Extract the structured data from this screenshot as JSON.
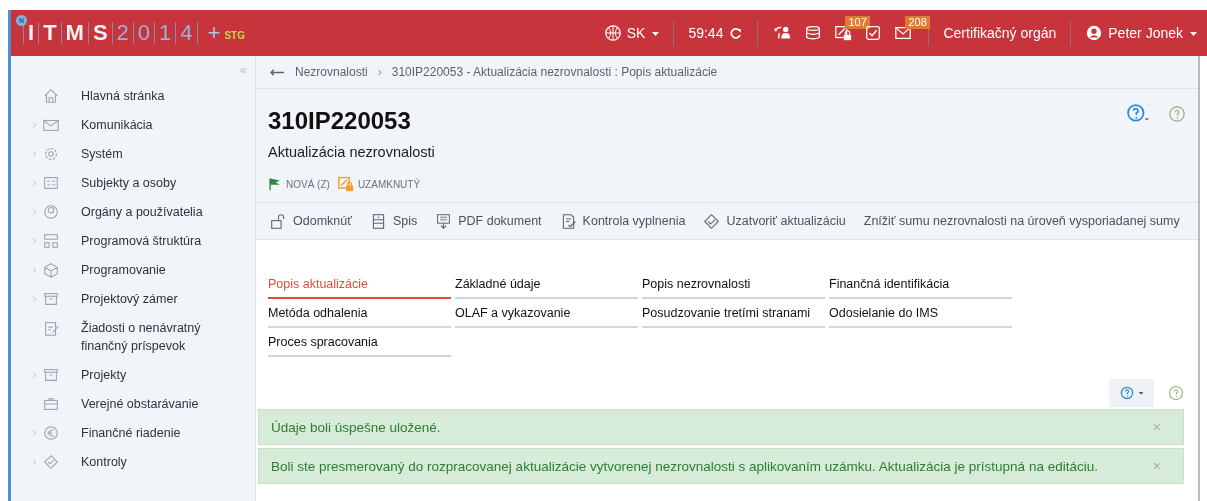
{
  "header": {
    "logo": {
      "badge": "N",
      "letters": [
        "I",
        "T",
        "M",
        "S"
      ],
      "digits": [
        "2",
        "0",
        "1",
        "4"
      ],
      "plus": "+",
      "env": "STG"
    },
    "language": "SK",
    "timer": "59:44",
    "tools": [
      {
        "kind": "person-swap"
      },
      {
        "kind": "stack"
      },
      {
        "kind": "lock-edit",
        "badge": "107"
      },
      {
        "kind": "check"
      },
      {
        "kind": "mail",
        "badge": "208"
      }
    ],
    "role": "Certifikačný orgán",
    "user": "Peter Jonek"
  },
  "sidebar": {
    "collapse": "«",
    "items": [
      {
        "label": "Hlavná stránka",
        "kind": "home",
        "expandable": false
      },
      {
        "label": "Komunikácia",
        "kind": "mail",
        "expandable": true
      },
      {
        "label": "Systém",
        "kind": "gear",
        "expandable": true
      },
      {
        "label": "Subjekty a osoby",
        "kind": "card",
        "expandable": true
      },
      {
        "label": "Orgány a používatelia",
        "kind": "user",
        "expandable": true
      },
      {
        "label": "Programová štruktúra",
        "kind": "tree",
        "expandable": true
      },
      {
        "label": "Programovanie",
        "kind": "cube",
        "expandable": true
      },
      {
        "label": "Projektový zámer",
        "kind": "box",
        "expandable": true
      },
      {
        "label": "Žiadosti o nenávratný finančný príspevok",
        "kind": "form",
        "expandable": false
      },
      {
        "label": "Projekty",
        "kind": "box",
        "expandable": true
      },
      {
        "label": "Verejné obstarávanie",
        "kind": "case",
        "expandable": false
      },
      {
        "label": "Finančné riadenie",
        "kind": "euro",
        "expandable": true
      },
      {
        "label": "Kontroly",
        "kind": "check",
        "expandable": true
      }
    ]
  },
  "breadcrumb": [
    "Nezrovnalosti",
    "310IP220053 - Aktualizácia nezrovnalosti : Popis aktualizácie"
  ],
  "record": {
    "code": "310IP220053",
    "subtitle": "Aktualizácia nezrovnalosti",
    "statuses": [
      {
        "label": "NOVÁ (Z)",
        "kind": "flag"
      },
      {
        "label": "UZAMKNUTÝ",
        "kind": "lock"
      }
    ]
  },
  "actions": [
    {
      "label": "Odomknúť",
      "kind": "unlock"
    },
    {
      "label": "Spis",
      "kind": "file"
    },
    {
      "label": "PDF dokument",
      "kind": "pdf"
    },
    {
      "label": "Kontrola vyplnenia",
      "kind": "check-doc"
    },
    {
      "label": "Uzatvoriť aktualizáciu",
      "kind": "diamond"
    },
    {
      "label": "Znížiť sumu nezrovnalosti na úroveň vysporiadanej sumy",
      "kind": "plain"
    }
  ],
  "tabs": [
    {
      "label": "Popis aktualizácie",
      "selected": true
    },
    {
      "label": "Základné údaje",
      "selected": false
    },
    {
      "label": "Popis nezrovnalosti",
      "selected": false
    },
    {
      "label": "Finančná identifikácia",
      "selected": false
    },
    {
      "label": "Metóda odhalenia",
      "selected": false
    },
    {
      "label": "OLAF a vykazovanie",
      "selected": false
    },
    {
      "label": "Posudzovanie tretími stranami",
      "selected": false
    },
    {
      "label": "Odosielanie do IMS",
      "selected": false
    },
    {
      "label": "Proces spracovania",
      "selected": false
    }
  ],
  "alerts": [
    {
      "text": "Údaje boli úspešne uložené.",
      "close": "×"
    },
    {
      "text": "Boli ste presmerovaný do rozpracovanej aktualizácie vytvorenej nezrovnalosti s aplikovaním uzámku. Aktualizácia je prístupná na editáciu.",
      "close": "×"
    }
  ]
}
